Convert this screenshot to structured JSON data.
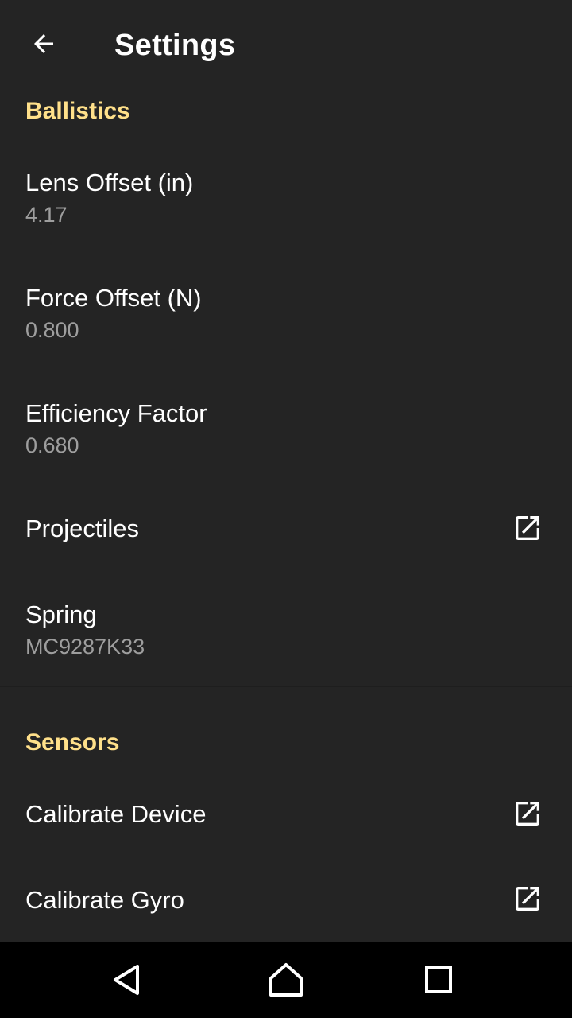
{
  "app_bar": {
    "title": "Settings",
    "back_icon": "arrow-back-icon"
  },
  "ballistics": {
    "header": "Ballistics",
    "lens_offset": {
      "title": "Lens Offset (in)",
      "summary": "4.17"
    },
    "force_offset": {
      "title": "Force Offset (N)",
      "summary": "0.800"
    },
    "efficiency_factor": {
      "title": "Efficiency Factor",
      "summary": "0.680"
    },
    "projectiles": {
      "title": "Projectiles",
      "icon": "open-in-new-icon"
    },
    "spring": {
      "title": "Spring",
      "summary": "MC9287K33"
    }
  },
  "sensors": {
    "header": "Sensors",
    "calibrate_device": {
      "title": "Calibrate Device",
      "icon": "open-in-new-icon"
    },
    "calibrate_gyro": {
      "title": "Calibrate Gyro",
      "icon": "open-in-new-icon"
    }
  },
  "nav_bar": {
    "back_icon": "triangle-back-icon",
    "home_icon": "home-icon",
    "recents_icon": "square-recents-icon"
  },
  "colors": {
    "background": "#242424",
    "category_accent": "#ffe08a",
    "title_text": "#ffffff",
    "summary_text": "#9e9e9e",
    "nav_bar": "#000000"
  }
}
